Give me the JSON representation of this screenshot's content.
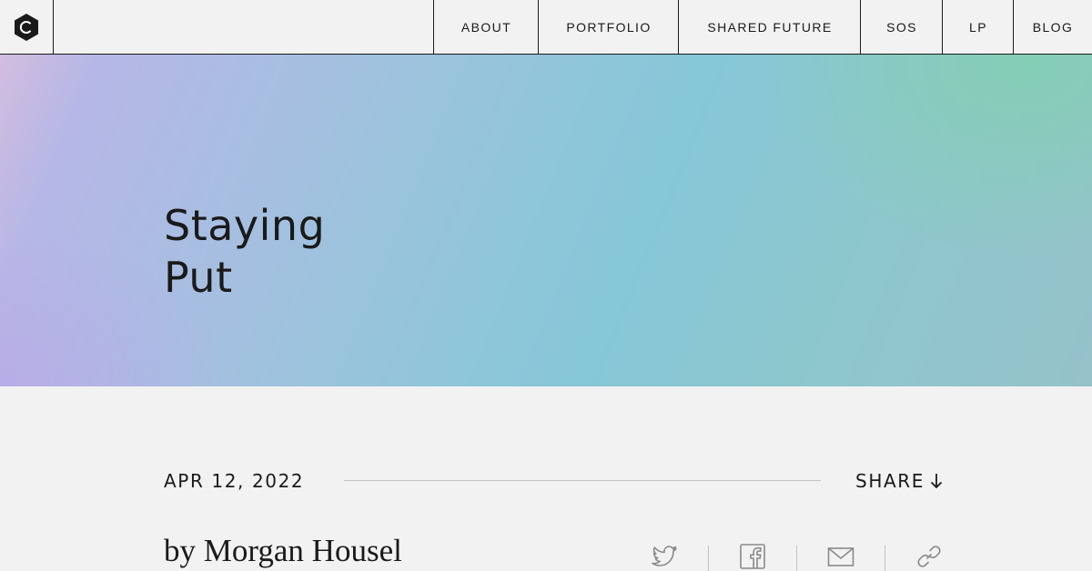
{
  "header": {
    "logo_icon": "hexagon-c-logo-icon",
    "nav": [
      {
        "label": "ABOUT"
      },
      {
        "label": "PORTFOLIO"
      },
      {
        "label": "SHARED FUTURE"
      },
      {
        "label": "SOS"
      },
      {
        "label": "LP"
      },
      {
        "label": "BLOG"
      }
    ]
  },
  "hero": {
    "title_line1": "Staying",
    "title_line2": "Put"
  },
  "post": {
    "date": "APR 12, 2022",
    "share_label": "SHARE",
    "share_icon": "arrow-down-icon",
    "author": "by Morgan Housel"
  },
  "social_icons": [
    "twitter-icon",
    "facebook-icon",
    "email-icon",
    "link-icon"
  ]
}
